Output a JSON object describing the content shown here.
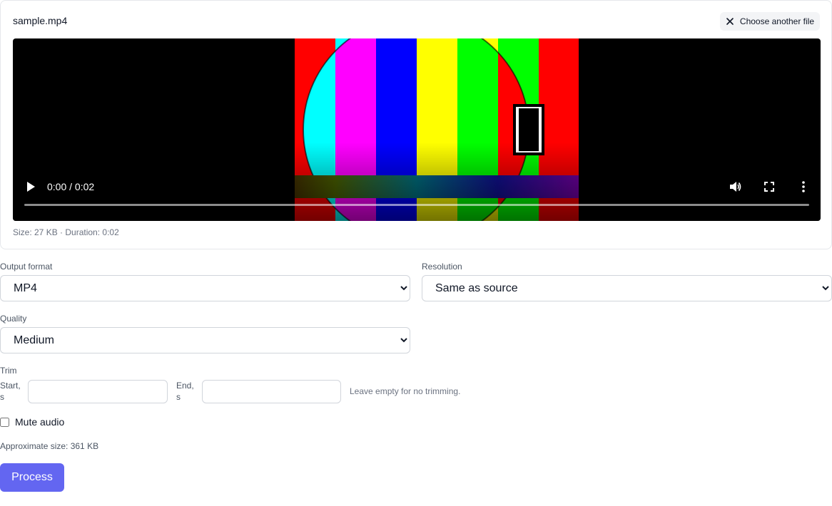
{
  "file": {
    "name": "sample.mp4",
    "choose_another_label": "Choose another file",
    "meta": "Size: 27 KB · Duration: 0:02"
  },
  "video": {
    "time_display": "0:00 / 0:02",
    "progress": 0.0,
    "icons": [
      "play-icon",
      "volume-icon",
      "fullscreen-icon",
      "more-options-icon",
      "close-icon"
    ],
    "test_pattern_colors": [
      "#ff0000",
      "#00ffff",
      "#ff00ff",
      "#0000ff",
      "#ffff00",
      "#00ff00",
      "#ff0000",
      "#ffffff"
    ]
  },
  "form": {
    "output_format": {
      "label": "Output format",
      "selected": "MP4"
    },
    "resolution": {
      "label": "Resolution",
      "selected": "Same as source"
    },
    "quality": {
      "label": "Quality",
      "selected": "Medium"
    },
    "trim": {
      "label": "Trim",
      "start_label": "Start,\ns",
      "start_value": "",
      "end_label": "End,\ns",
      "end_value": "",
      "hint": "Leave empty for no trimming."
    },
    "mute_audio": {
      "label": "Mute audio",
      "checked": false
    },
    "approx_size": "Approximate size: 361 KB",
    "process_label": "Process"
  },
  "colors": {
    "accent": "#6366f1",
    "muted_text": "#6b7280",
    "border": "#d1d5db"
  }
}
